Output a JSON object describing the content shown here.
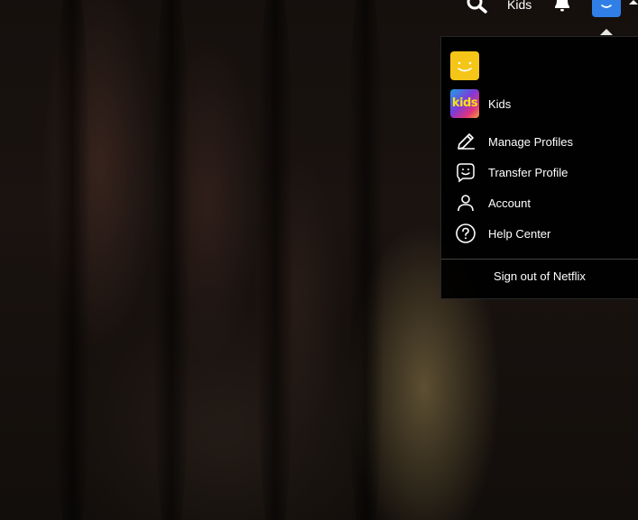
{
  "header": {
    "search_icon": "search-icon",
    "kids_label": "Kids",
    "notifications_icon": "bell-icon",
    "avatar_color": "#2f7fe6"
  },
  "dropdown": {
    "profiles": [
      {
        "name": "",
        "avatar": "smiley-avatar-yellow",
        "color": "#f5c518"
      },
      {
        "name": "Kids",
        "avatar": "kids-avatar",
        "avatar_text": "kids"
      }
    ],
    "menu": [
      {
        "label": "Manage Profiles",
        "icon": "pencil-icon"
      },
      {
        "label": "Transfer Profile",
        "icon": "transfer-profile-icon"
      },
      {
        "label": "Account",
        "icon": "person-icon"
      },
      {
        "label": "Help Center",
        "icon": "help-icon"
      }
    ],
    "signout_label": "Sign out of Netflix"
  }
}
